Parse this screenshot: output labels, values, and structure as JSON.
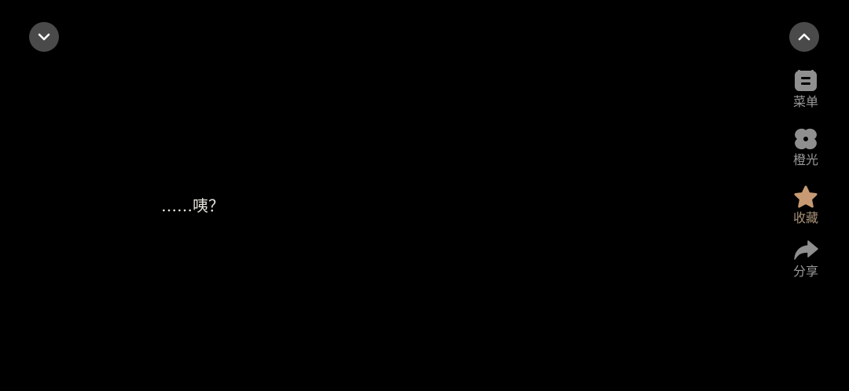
{
  "controls": {
    "collapse_icon": "chevron-down-icon",
    "expand_icon": "chevron-up-icon"
  },
  "side_menu": {
    "items": [
      {
        "id": "menu",
        "label": "菜单",
        "icon": "menu-card-icon"
      },
      {
        "id": "light",
        "label": "橙光",
        "icon": "orange-light-logo-icon"
      },
      {
        "id": "favorite",
        "label": "收藏",
        "icon": "star-icon",
        "color": "#c79a73"
      },
      {
        "id": "share",
        "label": "分享",
        "icon": "share-arrow-icon"
      }
    ]
  },
  "dialogue": {
    "text": "……咦？"
  },
  "colors": {
    "background": "#000000",
    "button_bg": "#4a4a4a",
    "icon_gray": "#8f8f8f",
    "favorite_accent": "#c79a73",
    "text": "#e6e6de"
  }
}
